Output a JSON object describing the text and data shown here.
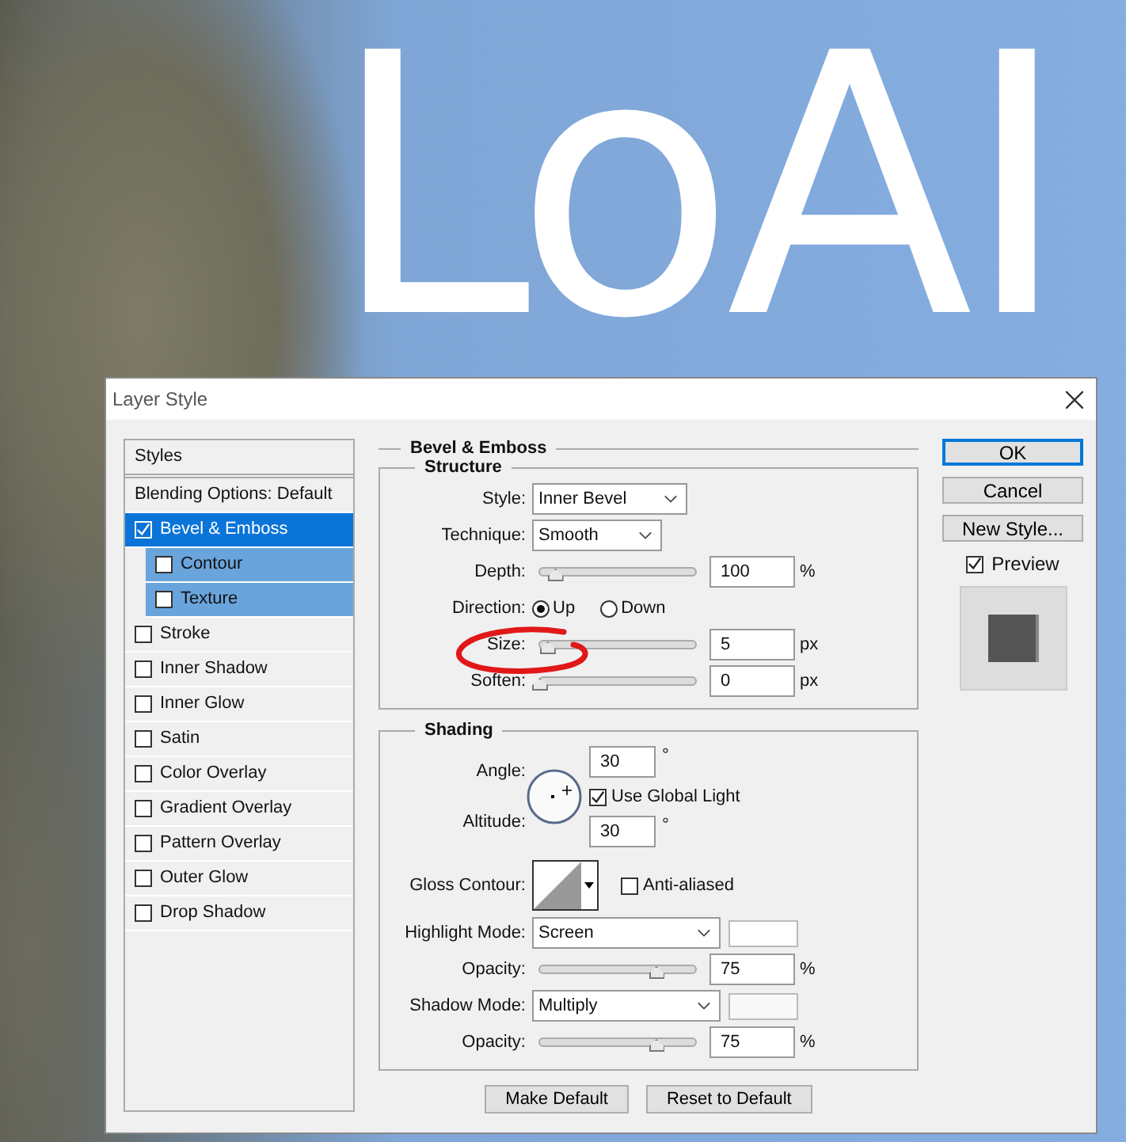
{
  "canvas": {
    "text": "LoAI"
  },
  "dialog": {
    "title": "Layer Style",
    "styles_list": [
      {
        "kind": "header",
        "label": "Styles"
      },
      {
        "kind": "option",
        "label": "Blending Options: Default",
        "selected": false
      },
      {
        "kind": "effect",
        "label": "Bevel & Emboss",
        "checked": true,
        "selected": true,
        "children": [
          {
            "label": "Contour",
            "checked": false,
            "selected": false
          },
          {
            "label": "Texture",
            "checked": false,
            "selected": false
          }
        ]
      },
      {
        "kind": "effect",
        "label": "Stroke",
        "checked": false,
        "selected": false
      },
      {
        "kind": "effect",
        "label": "Inner Shadow",
        "checked": false,
        "selected": false
      },
      {
        "kind": "effect",
        "label": "Inner Glow",
        "checked": false,
        "selected": false
      },
      {
        "kind": "effect",
        "label": "Satin",
        "checked": false,
        "selected": false
      },
      {
        "kind": "effect",
        "label": "Color Overlay",
        "checked": false,
        "selected": false
      },
      {
        "kind": "effect",
        "label": "Gradient Overlay",
        "checked": false,
        "selected": false
      },
      {
        "kind": "effect",
        "label": "Pattern Overlay",
        "checked": false,
        "selected": false
      },
      {
        "kind": "effect",
        "label": "Outer Glow",
        "checked": false,
        "selected": false
      },
      {
        "kind": "effect",
        "label": "Drop Shadow",
        "checked": false,
        "selected": false
      }
    ],
    "bevel_emboss": {
      "title": "Bevel & Emboss",
      "structure": {
        "title": "Structure",
        "style": {
          "label": "Style:",
          "value": "Inner Bevel"
        },
        "technique": {
          "label": "Technique:",
          "value": "Smooth"
        },
        "depth": {
          "label": "Depth:",
          "level": 0.1,
          "value": "100",
          "unit": "%"
        },
        "direction": {
          "label": "Direction:",
          "options": [
            {
              "label": "Up",
              "selected": true
            },
            {
              "label": "Down",
              "selected": false
            }
          ]
        },
        "size": {
          "label": "Size:",
          "level": 0.05,
          "value": "5",
          "unit": "px"
        },
        "soften": {
          "label": "Soften:",
          "level": 0,
          "value": "0",
          "unit": "px"
        }
      },
      "shading": {
        "title": "Shading",
        "angle": {
          "label": "Angle:",
          "value": "30",
          "unit": "°"
        },
        "use_global_light": {
          "label": "Use Global Light",
          "checked": true
        },
        "altitude": {
          "label": "Altitude:",
          "value": "30",
          "unit": "°"
        },
        "gloss_contour": {
          "label": "Gloss Contour:"
        },
        "anti_aliased": {
          "label": "Anti-aliased",
          "checked": false
        },
        "highlight_mode": {
          "label": "Highlight Mode:",
          "value": "Screen"
        },
        "highlight_opacity": {
          "label": "Opacity:",
          "level": 0.75,
          "value": "75",
          "unit": "%"
        },
        "shadow_mode": {
          "label": "Shadow Mode:",
          "value": "Multiply"
        },
        "shadow_opacity": {
          "label": "Opacity:",
          "level": 0.75,
          "value": "75",
          "unit": "%"
        }
      },
      "buttons": [
        "Make Default",
        "Reset to Default"
      ]
    },
    "side_buttons": [
      {
        "label": "OK",
        "default": true
      },
      {
        "label": "Cancel",
        "default": false
      },
      {
        "label": "New Style...",
        "default": false
      }
    ],
    "preview": {
      "label": "Preview",
      "checked": true
    }
  }
}
